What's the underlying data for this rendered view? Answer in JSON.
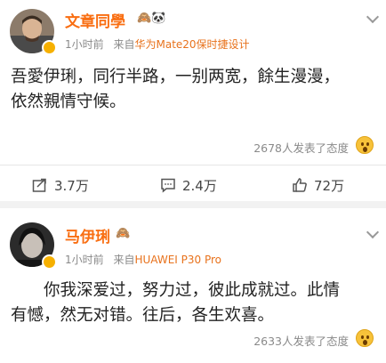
{
  "posts": [
    {
      "author": "文章同學",
      "emoji_after_name": "🙈🐼",
      "time": "1小时前",
      "source_prefix": "来自",
      "source": "华为Mate20保时捷设计",
      "text_line1": "吾愛伊琍，同行半路，一别两宽，餘生漫漫，",
      "text_line2": "依然親情守候。",
      "reaction_summary": "2678人发表了态度",
      "actions": {
        "share": "3.7万",
        "comment": "2.4万",
        "like": "72万"
      }
    },
    {
      "author": "马伊琍",
      "emoji_after_name": "🙈",
      "time": "1小时前",
      "source_prefix": "来自",
      "source": "HUAWEI P30 Pro",
      "text_line1": "你我深爱过，努力过，彼此成就过。此情",
      "text_line2": "有憾，然无对错。往后，各生欢喜。",
      "reaction_summary": "2633人发表了态度"
    }
  ],
  "colors": {
    "author": "#f96e12",
    "source": "#e8721c",
    "verified": "#f6b000"
  },
  "icons": [
    "share-icon",
    "comment-icon",
    "like-icon",
    "chevron-down-icon",
    "verified-badge-icon",
    "wow-emoji-icon"
  ]
}
